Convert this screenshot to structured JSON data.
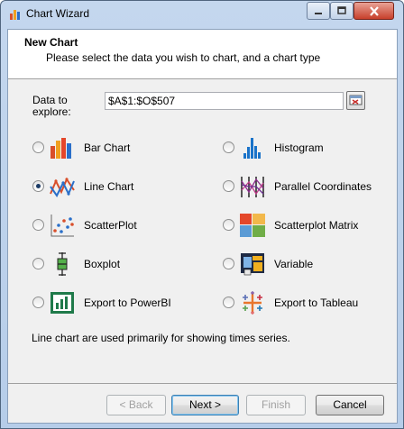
{
  "window": {
    "title": "Chart Wizard"
  },
  "header": {
    "title": "New Chart",
    "subtitle": "Please select the data you wish to chart, and a chart type"
  },
  "data_field": {
    "label": "Data to explore:",
    "value": "$A$1:$O$507"
  },
  "options": [
    {
      "label": "Bar Chart",
      "icon": "bar-chart-icon",
      "checked": false
    },
    {
      "label": "Histogram",
      "icon": "histogram-icon",
      "checked": false
    },
    {
      "label": "Line Chart",
      "icon": "line-chart-icon",
      "checked": true
    },
    {
      "label": "Parallel Coordinates",
      "icon": "parallel-coordinates-icon",
      "checked": false
    },
    {
      "label": "ScatterPlot",
      "icon": "scatterplot-icon",
      "checked": false
    },
    {
      "label": "Scatterplot Matrix",
      "icon": "scatterplot-matrix-icon",
      "checked": false
    },
    {
      "label": "Boxplot",
      "icon": "boxplot-icon",
      "checked": false
    },
    {
      "label": "Variable",
      "icon": "variable-icon",
      "checked": false
    },
    {
      "label": "Export to PowerBI",
      "icon": "powerbi-icon",
      "checked": false
    },
    {
      "label": "Export to Tableau",
      "icon": "tableau-icon",
      "checked": false
    }
  ],
  "description": "Line chart are used primarily for showing times series.",
  "buttons": {
    "back": "< Back",
    "next": "Next >",
    "finish": "Finish",
    "cancel": "Cancel"
  }
}
